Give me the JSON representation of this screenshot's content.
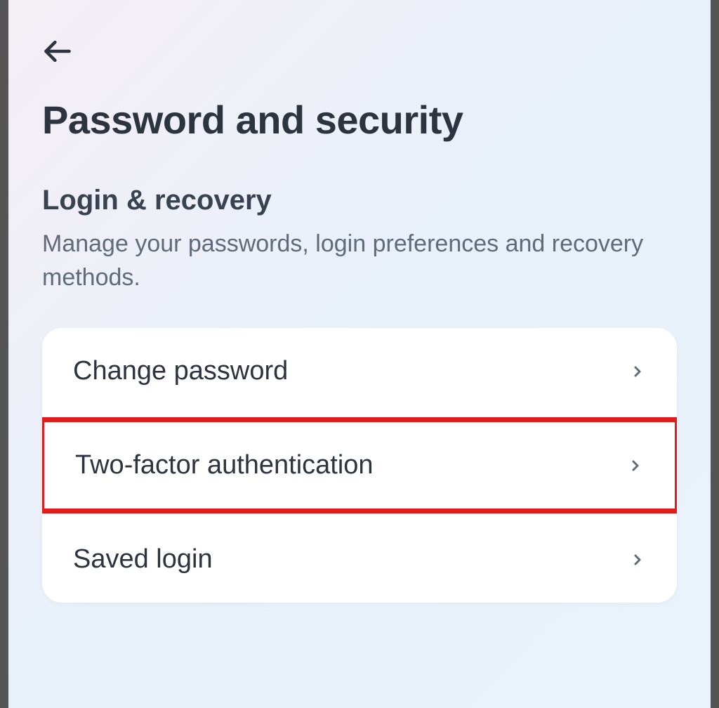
{
  "page": {
    "title": "Password and security"
  },
  "section": {
    "title": "Login & recovery",
    "description": "Manage your passwords, login preferences and recovery methods."
  },
  "list": {
    "items": [
      {
        "label": "Change password"
      },
      {
        "label": "Two-factor authentication"
      },
      {
        "label": "Saved login"
      }
    ]
  }
}
